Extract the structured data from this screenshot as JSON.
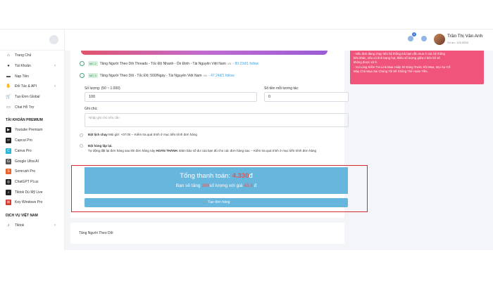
{
  "user": {
    "name": "Trần Thị Vân Anh",
    "balance": "Số dư: 100.000đ",
    "notification_count": "1"
  },
  "sidebar": {
    "items": [
      {
        "label": "Trang Chủ",
        "icon": "home-icon",
        "glyph": "⌂"
      },
      {
        "label": "Tài Khoản",
        "icon": "user-icon",
        "glyph": "●"
      },
      {
        "label": "Nạp Tiền",
        "icon": "wallet-icon",
        "glyph": "▬"
      },
      {
        "label": "Đối Tác & API",
        "icon": "handshake-icon",
        "glyph": "✋"
      },
      {
        "label": "Tạo Đơn Global",
        "icon": "cart-icon",
        "glyph": "🛒"
      },
      {
        "label": "Chat Hỗ Trợ",
        "icon": "chat-icon",
        "glyph": "▭"
      }
    ],
    "section_premium": "TÀI KHOẢN PREMIUM",
    "premium_items": [
      {
        "label": "Youtube Premium",
        "icon": "youtube-icon",
        "glyph": "▶",
        "color": "#222222"
      },
      {
        "label": "Capcut Pro",
        "icon": "capcut-icon",
        "glyph": "✂",
        "color": "#222222"
      },
      {
        "label": "Canva Pro",
        "icon": "canva-icon",
        "glyph": "C",
        "color": "#2bb5d6"
      },
      {
        "label": "Google Ultra AI",
        "icon": "google-icon",
        "glyph": "G",
        "color": "#555555"
      },
      {
        "label": "Semrush Pro",
        "icon": "semrush-icon",
        "glyph": "S",
        "color": "#e8632a"
      },
      {
        "label": "ChatGPT PLus",
        "icon": "chatgpt-icon",
        "glyph": "◎",
        "color": "#222222"
      },
      {
        "label": "Tiktok Dú Mỹ Live",
        "icon": "tiktok-icon",
        "glyph": "♪",
        "color": "#222222"
      },
      {
        "label": "Key Windows Pro",
        "icon": "windows-icon",
        "glyph": "⊞",
        "color": "#d63b2f"
      }
    ],
    "section_vn": "DỊCH VỤ VIỆT NAM",
    "vn_items": [
      {
        "label": "Tiktok",
        "icon": "tiktok-icon",
        "glyph": "♪"
      }
    ]
  },
  "services": [
    {
      "server": "MC 2",
      "name": "Tăng Người Theo Dõi Threads - Tốc Độ Nhanh - Ổn Định - Tài Nguyên Việt Nam",
      "country": "VN",
      "price": "- 80.23đ/1 follow"
    },
    {
      "server": "MC 3",
      "name": "Tăng Người Theo Dõi - Tốc Độ: 500/Ngày - Tài Nguyên Việt Nam",
      "country": "VN",
      "price": "- 47.24đ/1 follow"
    }
  ],
  "form": {
    "quantity_label": "Số lượng: (50 ~ 1.000)",
    "quantity_value": "100",
    "price_label": "Số tiền mỗi tương tác:",
    "price_value": "0",
    "note_label": "Ghi chú:",
    "note_placeholder": "Nhập ghi chú nếu cần",
    "schedule_label": "Đặt lịch chạy",
    "schedule_text": "Múi giờ: +07:00 -- Kiểm tra quá trình ở mục tiến trình đơn hàng",
    "repeat_label": "Đặt hàng lặp lại.",
    "repeat_text_1": "Tự động đặt lại đơn hàng sau khi đơn hàng này",
    "repeat_bold": "HOÀN THÀNH",
    "repeat_text_2": ". Đảm bảo số dư của bạn đủ cho các đơn hàng sau -- Kiểm tra quá trình ở mục tiến trình đơn hàng"
  },
  "total": {
    "label": "Tổng thanh toán:",
    "amount": "4.330",
    "currency": "đ",
    "sub_prefix": "Bạn sẽ tăng",
    "sub_qty": "100",
    "sub_middle": "số lượng với giá",
    "sub_price": "43.3",
    "sub_currency": "đ"
  },
  "order_button": "Tạo đơn hàng",
  "second_card_title": "Tăng Người Theo Dõi",
  "notice_lines": [
    "- Nếu đơn đang chạy trên hệ thống mà bạn vẫn mua ở các hệ thống",
    "bên khác, nếu có tình trạng hụt, thiếu số lượng giữa 2 bên thì sẽ",
    "không được xử lí.",
    "- Vui Lòng Kiểm Tra Link Mua Hoặc ID Đúng Trước Khi Mua, Mọi Sự Cố",
    "Máy Chủ Mua Sai Chúng Tôi Sẽ Không Thể Hoàn Tiền."
  ],
  "colors": {
    "accent": "#67b6dd",
    "highlight": "#d9282f",
    "notice": "#f0547a"
  }
}
